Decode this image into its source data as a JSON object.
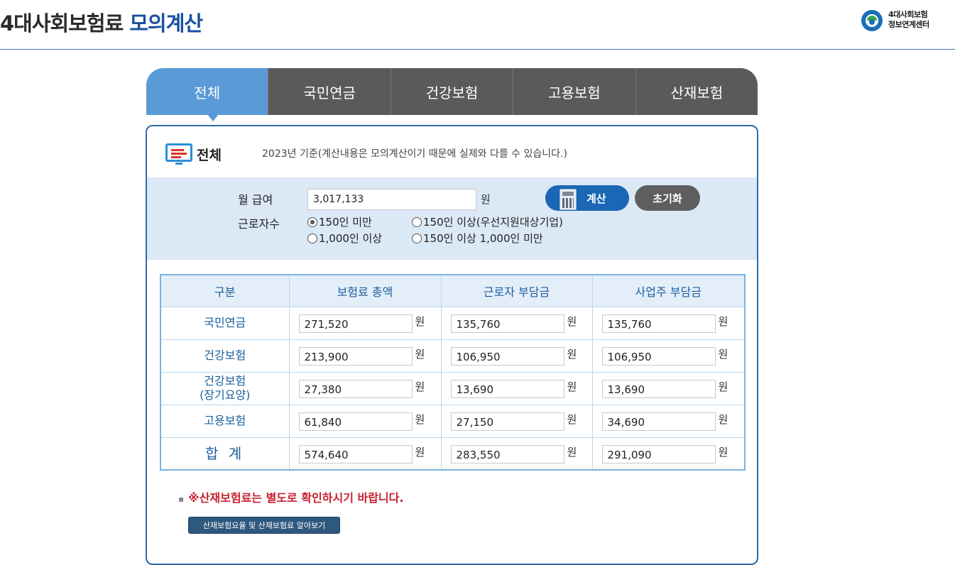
{
  "header": {
    "title_main": "4대사회보험료",
    "title_accent": "모의계산",
    "brand_line1": "4대사회보험",
    "brand_line2": "정보연계센터"
  },
  "tabs": [
    {
      "label": "전체",
      "active": true
    },
    {
      "label": "국민연금",
      "active": false
    },
    {
      "label": "건강보험",
      "active": false
    },
    {
      "label": "고용보험",
      "active": false
    },
    {
      "label": "산재보험",
      "active": false
    }
  ],
  "panel": {
    "icon": "monitor-icon",
    "title": "전체",
    "note": "2023년 기준(계산내용은 모의계산이기 때문에 실제와 다를 수 있습니다.)"
  },
  "form": {
    "salary_label": "월 급여",
    "salary_value": "3,017,133",
    "salary_unit": "원",
    "calc_button": "계산",
    "reset_button": "초기화",
    "workers_label": "근로자수",
    "worker_options": [
      {
        "label": "150인 미만",
        "checked": true
      },
      {
        "label": "150인 이상(우선지원대상기업)",
        "checked": false
      },
      {
        "label": "1,000인 이상",
        "checked": false
      },
      {
        "label": "150인 이상 1,000인 미만",
        "checked": false
      }
    ]
  },
  "table": {
    "headers": [
      "구분",
      "보험료 총액",
      "근로자 부담금",
      "사업주 부담금"
    ],
    "unit": "원",
    "rows": [
      {
        "category": "국민연금",
        "total": "271,520",
        "employee": "135,760",
        "employer": "135,760"
      },
      {
        "category": "건강보험",
        "total": "213,900",
        "employee": "106,950",
        "employer": "106,950"
      },
      {
        "category": "건강보험",
        "category_sub": "(장기요양)",
        "total": "27,380",
        "employee": "13,690",
        "employer": "13,690"
      },
      {
        "category": "고용보험",
        "total": "61,840",
        "employee": "27,150",
        "employer": "34,690"
      },
      {
        "category": "합 계",
        "total": "574,640",
        "employee": "283,550",
        "employer": "291,090"
      }
    ]
  },
  "footer": {
    "notice": "※산재보험료는 별도로 확인하시기 바랍니다.",
    "link_button": "산재보험요율 및 산재보험료 알아보기"
  },
  "colors": {
    "accent": "#1a4fa0",
    "active_tab": "#5a9ad6",
    "inactive_tab": "#5a5a5a",
    "calc_button": "#1a67b5",
    "notice_red": "#c8202e"
  }
}
